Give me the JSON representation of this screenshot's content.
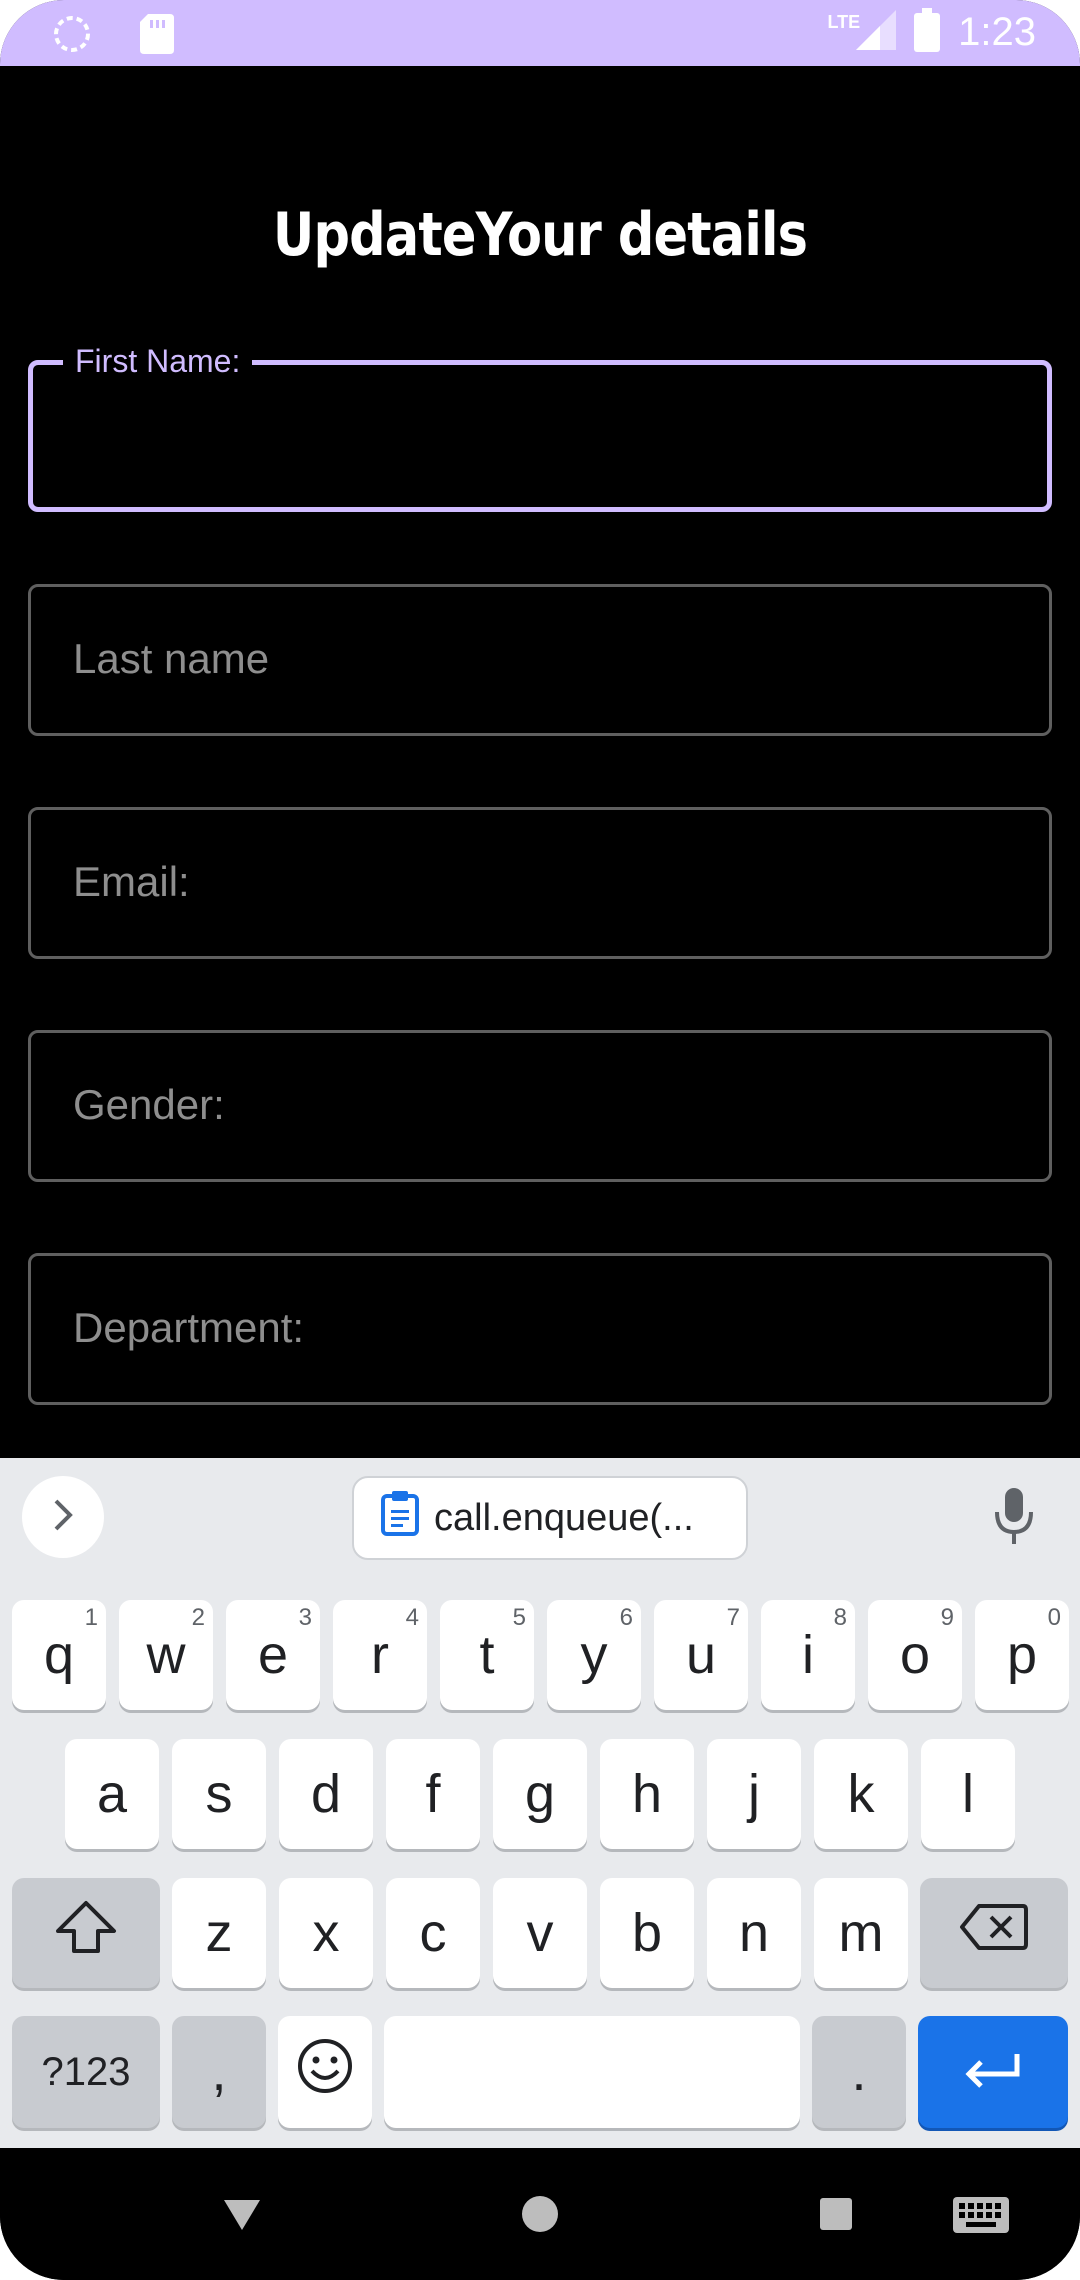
{
  "status_bar": {
    "time": "1:23",
    "network": "LTE",
    "bg_color": "#d0bcff"
  },
  "page": {
    "title": "UpdateYour details"
  },
  "form": {
    "first_name_label": "First Name:",
    "first_name_value": "",
    "last_name_placeholder": "Last name",
    "email_placeholder": "Email:",
    "gender_placeholder": "Gender:",
    "department_placeholder": "Department:"
  },
  "keyboard": {
    "clipboard_suggestion": "call.enqueue(...",
    "row1": [
      {
        "key": "q",
        "hint": "1"
      },
      {
        "key": "w",
        "hint": "2"
      },
      {
        "key": "e",
        "hint": "3"
      },
      {
        "key": "r",
        "hint": "4"
      },
      {
        "key": "t",
        "hint": "5"
      },
      {
        "key": "y",
        "hint": "6"
      },
      {
        "key": "u",
        "hint": "7"
      },
      {
        "key": "i",
        "hint": "8"
      },
      {
        "key": "o",
        "hint": "9"
      },
      {
        "key": "p",
        "hint": "0"
      }
    ],
    "row2": [
      "a",
      "s",
      "d",
      "f",
      "g",
      "h",
      "j",
      "k",
      "l"
    ],
    "row3": [
      "z",
      "x",
      "c",
      "v",
      "b",
      "n",
      "m"
    ],
    "symbols_label": "?123",
    "comma_label": ",",
    "period_label": ".",
    "accent_color": "#1a73e8"
  },
  "icons": {
    "status_left": [
      "circle-icon",
      "sd-card-icon"
    ],
    "status_right": [
      "signal-icon",
      "battery-icon"
    ],
    "keyboard": [
      "chevron-right-icon",
      "clipboard-icon",
      "mic-icon",
      "shift-icon",
      "backspace-icon",
      "emoji-icon",
      "enter-icon"
    ],
    "nav": [
      "back-icon",
      "home-icon",
      "recents-icon",
      "keyboard-icon"
    ]
  }
}
